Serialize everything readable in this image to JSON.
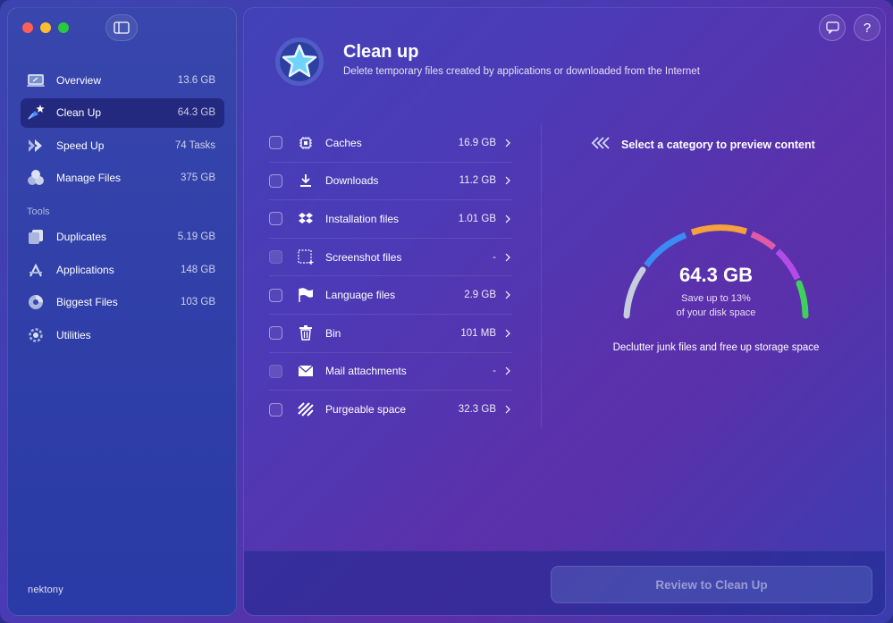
{
  "app": {
    "brand": "nektony"
  },
  "sidebar": {
    "items": [
      {
        "label": "Overview",
        "value": "13.6 GB",
        "icon": "laptop-icon",
        "active": false
      },
      {
        "label": "Clean Up",
        "value": "64.3 GB",
        "icon": "sparkle-broom-icon",
        "active": true
      },
      {
        "label": "Speed Up",
        "value": "74 Tasks",
        "icon": "speed-chevrons-icon",
        "active": false
      },
      {
        "label": "Manage Files",
        "value": "375 GB",
        "icon": "cubes-icon",
        "active": false
      }
    ],
    "tools_header": "Tools",
    "tools": [
      {
        "label": "Duplicates",
        "value": "5.19 GB",
        "icon": "duplicates-icon"
      },
      {
        "label": "Applications",
        "value": "148 GB",
        "icon": "app-store-icon"
      },
      {
        "label": "Biggest Files",
        "value": "103 GB",
        "icon": "pie-icon"
      },
      {
        "label": "Utilities",
        "value": "",
        "icon": "gear-icon"
      }
    ]
  },
  "main": {
    "title": "Clean up",
    "subtitle": "Delete temporary files created by applications or downloaded from the Internet",
    "categories": [
      {
        "label": "Caches",
        "size": "16.9 GB",
        "icon": "chip-icon",
        "enabled": true
      },
      {
        "label": "Downloads",
        "size": "11.2 GB",
        "icon": "download-icon",
        "enabled": true
      },
      {
        "label": "Installation files",
        "size": "1.01 GB",
        "icon": "dropbox-icon",
        "enabled": true
      },
      {
        "label": "Screenshot files",
        "size": "-",
        "icon": "screenshot-icon",
        "enabled": false
      },
      {
        "label": "Language files",
        "size": "2.9 GB",
        "icon": "flag-icon",
        "enabled": true
      },
      {
        "label": "Bin",
        "size": "101 MB",
        "icon": "trash-icon",
        "enabled": true
      },
      {
        "label": "Mail attachments",
        "size": "-",
        "icon": "mail-icon",
        "enabled": false
      },
      {
        "label": "Purgeable space",
        "size": "32.3 GB",
        "icon": "stripes-icon",
        "enabled": true
      }
    ],
    "preview_hint": "Select a category to preview content",
    "gauge": {
      "value": "64.3 GB",
      "line1": "Save up to 13%",
      "line2": "of your disk space",
      "segments": [
        "#c7cedb",
        "#3c8bf5",
        "#f5a13c",
        "#e05aa8",
        "#b34ce6",
        "#3fcf5a"
      ]
    },
    "declutter": "Declutter junk files and free up storage space",
    "review_button": "Review to Clean Up"
  }
}
